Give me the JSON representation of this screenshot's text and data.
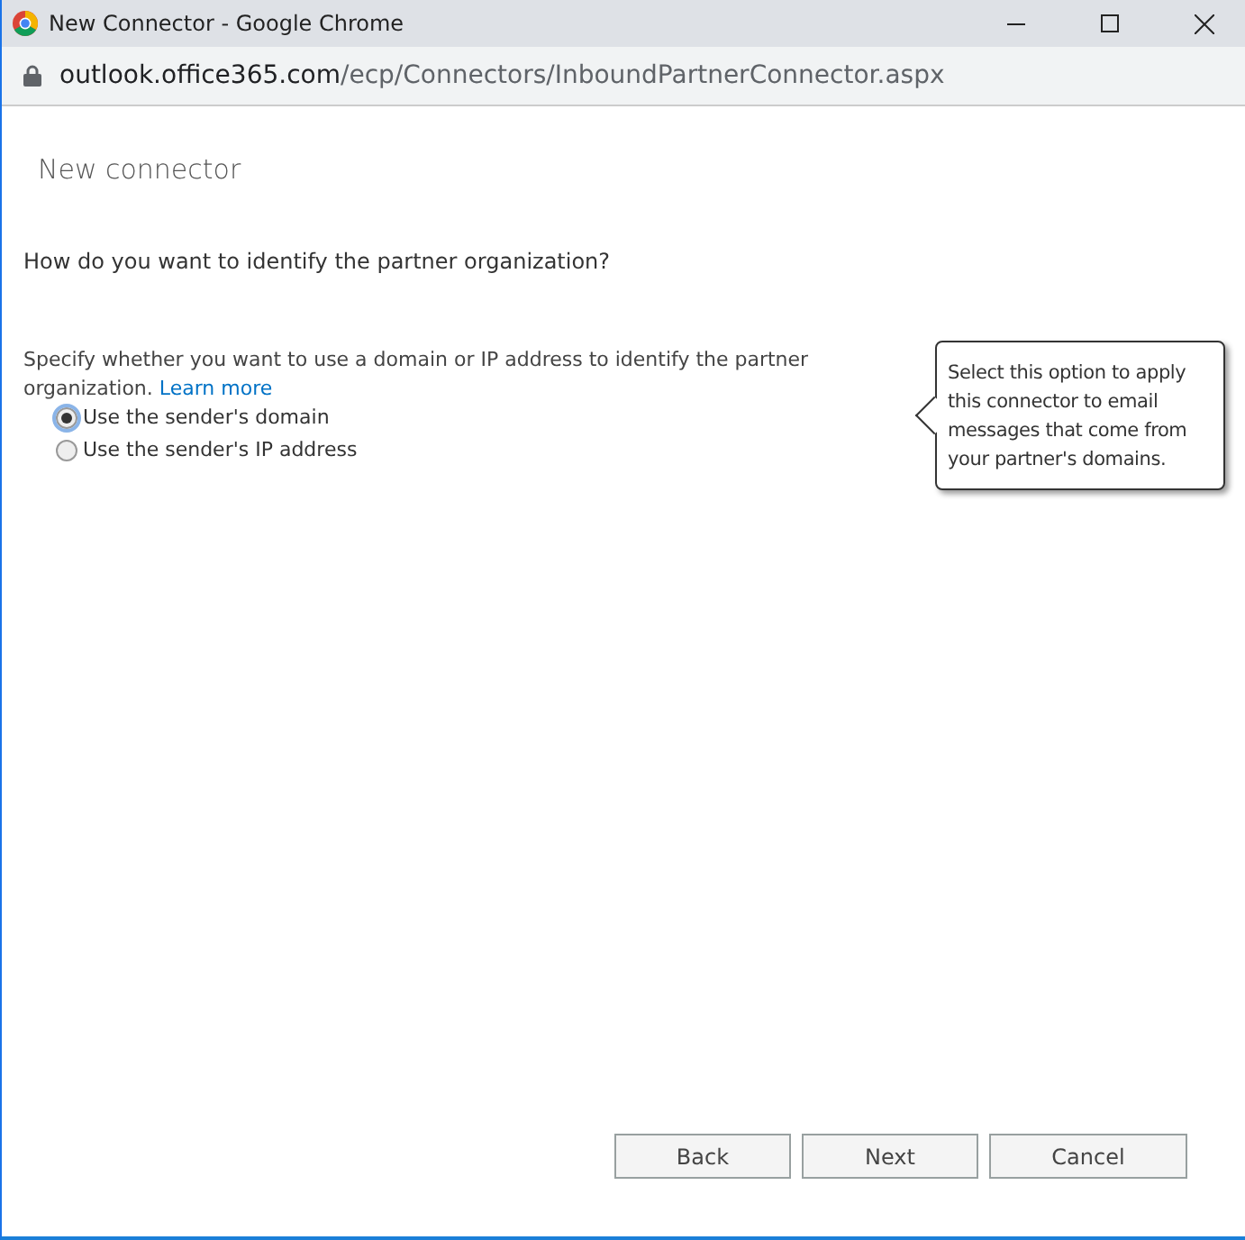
{
  "window": {
    "title": "New Connector - Google Chrome"
  },
  "address_bar": {
    "host": "outlook.office365.com",
    "path": "/ecp/Connectors/InboundPartnerConnector.aspx"
  },
  "page": {
    "heading": "New connector",
    "question": "How do you want to identify the partner organization?",
    "description": "Specify whether you want to use a domain or IP address to identify the partner organization.",
    "link": "Learn more",
    "options": [
      {
        "label": "Use the sender's domain",
        "selected": true
      },
      {
        "label": "Use the sender's IP address",
        "selected": false
      }
    ],
    "tooltip": "Select this option to apply this connector to email messages that come from your partner's domains."
  },
  "buttons": [
    "Back",
    "Next",
    "Cancel"
  ]
}
